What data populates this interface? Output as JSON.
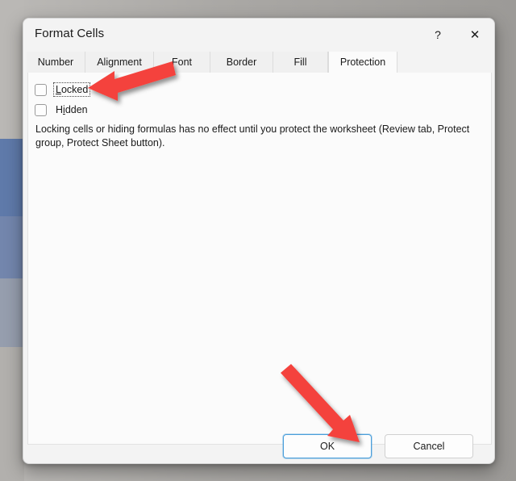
{
  "window": {
    "title": "Format Cells",
    "help_button": "?",
    "close_button": "✕",
    "help_icon_name": "help-icon",
    "close_icon_name": "close-icon"
  },
  "tabs": [
    {
      "label": "Number",
      "active": false
    },
    {
      "label": "Alignment",
      "active": false
    },
    {
      "label": "Font",
      "active": false
    },
    {
      "label": "Border",
      "active": false
    },
    {
      "label": "Fill",
      "active": false
    },
    {
      "label": "Protection",
      "active": true
    }
  ],
  "protection": {
    "checkboxes": [
      {
        "label": "Locked",
        "mnemonic": "L",
        "checked": false,
        "focused": true
      },
      {
        "label": "Hidden",
        "mnemonic": "i",
        "checked": false,
        "focused": false
      }
    ],
    "description": "Locking cells or hiding formulas has no effect until you protect the worksheet (Review tab, Protect group, Protect Sheet button)."
  },
  "footer": {
    "ok_label": "OK",
    "cancel_label": "Cancel"
  },
  "annotations": [
    {
      "name": "arrow-to-locked-checkbox",
      "points_to": "Locked",
      "color": "#f4433c"
    },
    {
      "name": "arrow-to-ok-button",
      "points_to": "OK",
      "color": "#f4433c"
    }
  ],
  "colors": {
    "accent": "#4a9eda",
    "annotation": "#f4433c",
    "dialog_bg": "#f3f3f3",
    "panel_bg": "#fbfbfb",
    "text": "#1b1b1b"
  }
}
